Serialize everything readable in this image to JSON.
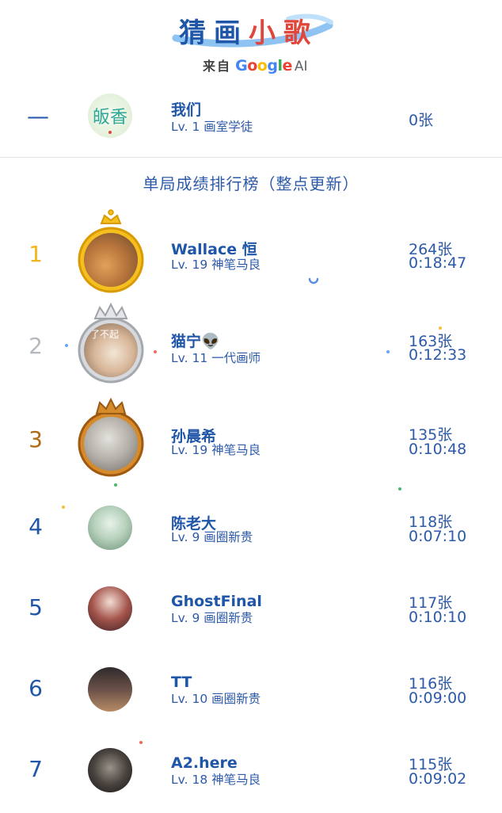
{
  "header": {
    "title_part1": "猜画",
    "title_part2": "小歌",
    "from_label": "来自",
    "brand": [
      "G",
      "o",
      "o",
      "g",
      "l",
      "e"
    ],
    "brand_suffix": "AI"
  },
  "me": {
    "rank": "—",
    "avatar_text": "皈香",
    "name": "我们",
    "level": "Lv. 1 画室学徒",
    "count": "0张"
  },
  "section_title": "单局成绩排行榜（整点更新）",
  "leaderboard": [
    {
      "rank": "1",
      "name": "Wallace 恒",
      "level": "Lv. 19 神笔马良",
      "count": "264张",
      "time": "0:18:47",
      "rank_color": "#f2b51d",
      "frame": "gold-crown"
    },
    {
      "rank": "2",
      "name": "猫宁👽",
      "level": "Lv. 11 一代画师",
      "count": "163张",
      "time": "0:12:33",
      "rank_color": "#b5b9bf",
      "frame": "silver-crown",
      "avatar_text": "了不起"
    },
    {
      "rank": "3",
      "name": "孙晨希",
      "level": "Lv. 19 神笔马良",
      "count": "135张",
      "time": "0:10:48",
      "rank_color": "#b06a12",
      "frame": "bronze-crown"
    },
    {
      "rank": "4",
      "name": "陈老大",
      "level": "Lv. 9 画圈新贵",
      "count": "118张",
      "time": "0:07:10",
      "rank_color": "#1f56a8"
    },
    {
      "rank": "5",
      "name": "GhostFinal",
      "level": "Lv. 9 画圈新贵",
      "count": "117张",
      "time": "0:10:10",
      "rank_color": "#1f56a8"
    },
    {
      "rank": "6",
      "name": "TT",
      "level": "Lv. 10 画圈新贵",
      "count": "116张",
      "time": "0:09:00",
      "rank_color": "#1f56a8"
    },
    {
      "rank": "7",
      "name": "A2.here",
      "level": "Lv. 18 神笔马良",
      "count": "115张",
      "time": "0:09:02",
      "rank_color": "#1f56a8"
    }
  ],
  "colors": {
    "primary_blue": "#1f56a8",
    "gold": "#f2b51d",
    "silver": "#b5b9bf",
    "bronze": "#b06a12",
    "title_red": "#e2463b"
  }
}
